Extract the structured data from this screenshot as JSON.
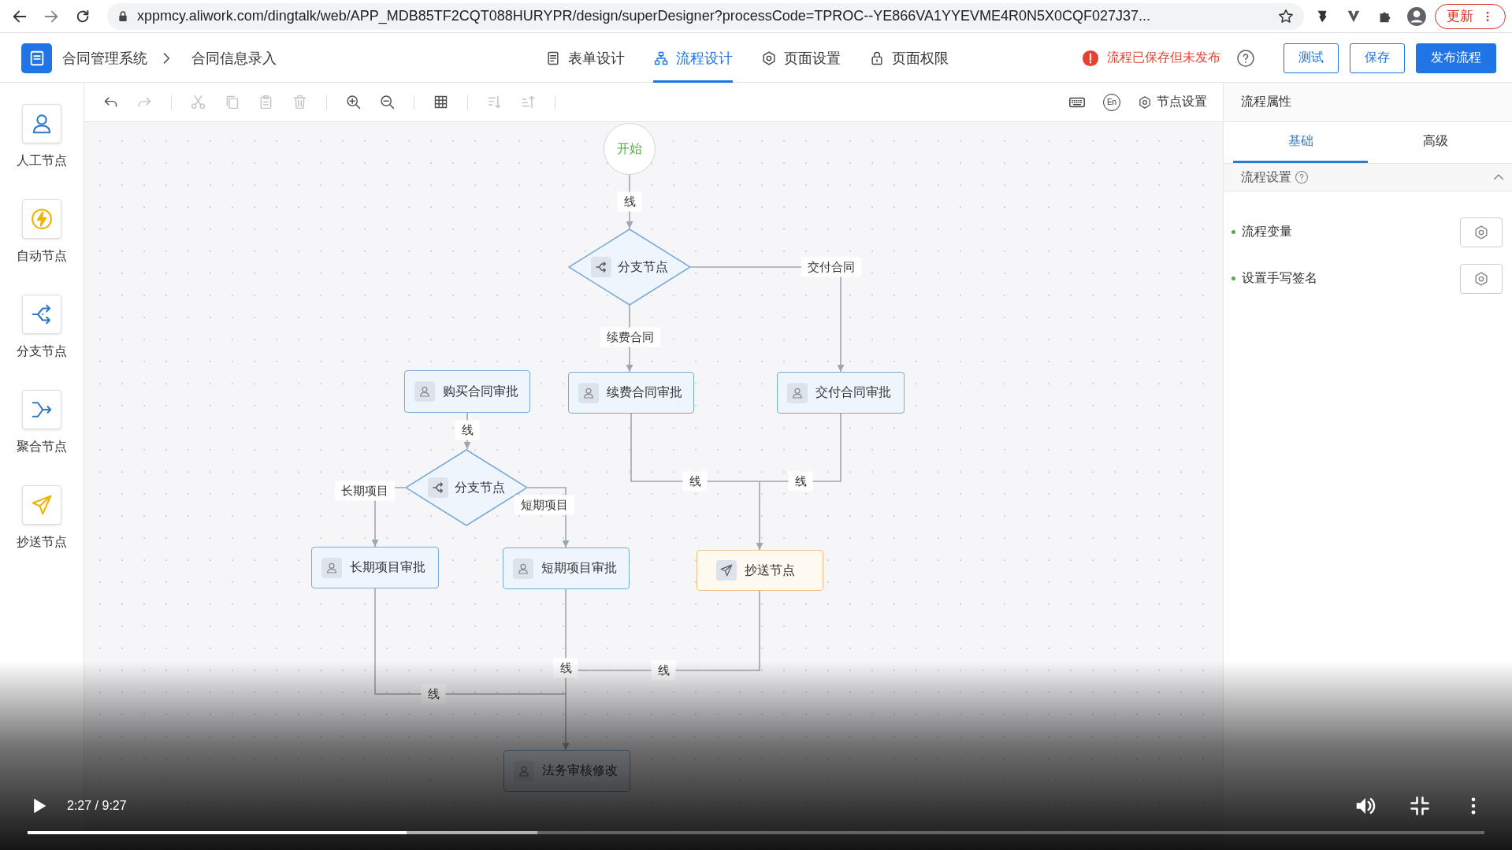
{
  "browser": {
    "url": "xppmcy.aliwork.com/dingtalk/web/APP_MDB85TF2CQT088HURYPR/design/superDesigner?processCode=TPROC--YE866VA1YYEVME4R0N5X0CQF027J37...",
    "update_button": "更新"
  },
  "header": {
    "breadcrumb": [
      "合同管理系统",
      "合同信息录入"
    ],
    "tabs": [
      {
        "kind": "form",
        "label": "表单设计",
        "selected": false
      },
      {
        "kind": "flow",
        "label": "流程设计",
        "selected": true
      },
      {
        "kind": "settings",
        "label": "页面设置",
        "selected": false
      },
      {
        "kind": "lock",
        "label": "页面权限",
        "selected": false
      }
    ],
    "status": "流程已保存但未发布",
    "buttons": [
      {
        "kind": "outline",
        "label": "测试"
      },
      {
        "kind": "outline",
        "label": "保存"
      },
      {
        "kind": "primary",
        "label": "发布流程"
      }
    ]
  },
  "palette": [
    {
      "kind": "person",
      "label": "人工节点"
    },
    {
      "kind": "auto",
      "label": "自动节点"
    },
    {
      "kind": "branch",
      "label": "分支节点"
    },
    {
      "kind": "merge",
      "label": "聚合节点"
    },
    {
      "kind": "send",
      "label": "抄送节点"
    }
  ],
  "toolbar": {
    "tools": [
      {
        "kind": "undo",
        "disabled": false
      },
      {
        "kind": "redo",
        "disabled": true
      },
      {
        "kind": "separator"
      },
      {
        "kind": "cut",
        "disabled": true
      },
      {
        "kind": "copy",
        "disabled": true
      },
      {
        "kind": "paste",
        "disabled": true
      },
      {
        "kind": "delete",
        "disabled": true
      },
      {
        "kind": "separator"
      },
      {
        "kind": "zoom-in",
        "disabled": false
      },
      {
        "kind": "zoom-out",
        "disabled": false
      },
      {
        "kind": "separator"
      },
      {
        "kind": "grid",
        "disabled": false
      },
      {
        "kind": "separator"
      },
      {
        "kind": "sort-down",
        "disabled": true
      },
      {
        "kind": "sort-up",
        "disabled": true
      },
      {
        "kind": "separator"
      }
    ],
    "language_toggle": "En",
    "node_settings": "节点设置"
  },
  "diagram": {
    "nodes": [
      {
        "kind": "start",
        "label": "开始"
      },
      {
        "kind": "branch",
        "label": "分支节点"
      },
      {
        "kind": "task",
        "label": "购买合同审批"
      },
      {
        "kind": "task",
        "label": "续费合同审批"
      },
      {
        "kind": "task",
        "label": "交付合同审批"
      },
      {
        "kind": "branch",
        "label": "分支节点"
      },
      {
        "kind": "task",
        "label": "长期项目审批"
      },
      {
        "kind": "task",
        "label": "短期项目审批"
      },
      {
        "kind": "copy",
        "label": "抄送节点"
      },
      {
        "kind": "task",
        "label": "法务审核修改"
      }
    ],
    "edge_labels": [
      "线",
      "交付合同",
      "续费合同",
      "线",
      "长期项目",
      "短期项目",
      "线",
      "线",
      "线",
      "线",
      "线"
    ]
  },
  "properties": {
    "title": "流程属性",
    "tabs": [
      {
        "label": "基础",
        "selected": true
      },
      {
        "label": "高级",
        "selected": false
      }
    ],
    "section": {
      "title": "流程设置",
      "expanded": true
    },
    "items": [
      "流程变量",
      "设置手写签名"
    ]
  },
  "video": {
    "playing": false,
    "time": "2:27 / 9:27",
    "level": 0.26
  }
}
